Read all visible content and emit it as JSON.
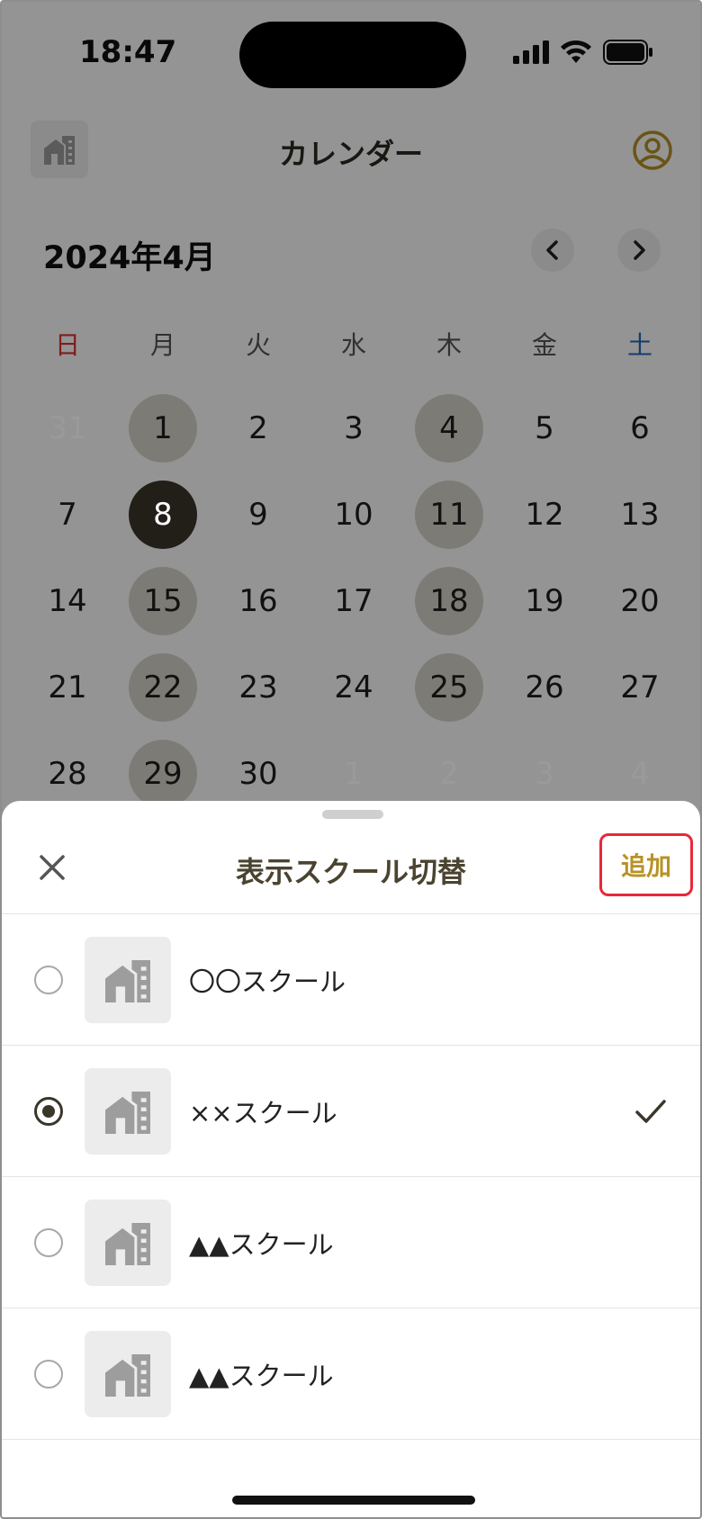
{
  "status_bar": {
    "time": "18:47"
  },
  "header": {
    "title": "カレンダー"
  },
  "calendar": {
    "month_label": "2024年4月",
    "weekdays": [
      "日",
      "月",
      "火",
      "水",
      "木",
      "金",
      "土"
    ],
    "weeks": [
      [
        {
          "d": "31",
          "outside": true
        },
        {
          "d": "1",
          "marked": true
        },
        {
          "d": "2"
        },
        {
          "d": "3"
        },
        {
          "d": "4",
          "marked": true
        },
        {
          "d": "5"
        },
        {
          "d": "6"
        }
      ],
      [
        {
          "d": "7"
        },
        {
          "d": "8",
          "selected": true
        },
        {
          "d": "9"
        },
        {
          "d": "10"
        },
        {
          "d": "11",
          "marked": true
        },
        {
          "d": "12"
        },
        {
          "d": "13"
        }
      ],
      [
        {
          "d": "14"
        },
        {
          "d": "15",
          "marked": true
        },
        {
          "d": "16"
        },
        {
          "d": "17"
        },
        {
          "d": "18",
          "marked": true
        },
        {
          "d": "19"
        },
        {
          "d": "20"
        }
      ],
      [
        {
          "d": "21"
        },
        {
          "d": "22",
          "marked": true
        },
        {
          "d": "23"
        },
        {
          "d": "24"
        },
        {
          "d": "25",
          "marked": true
        },
        {
          "d": "26"
        },
        {
          "d": "27"
        }
      ],
      [
        {
          "d": "28"
        },
        {
          "d": "29",
          "marked": true
        },
        {
          "d": "30"
        },
        {
          "d": "1",
          "outside": true
        },
        {
          "d": "2",
          "outside": true
        },
        {
          "d": "3",
          "outside": true
        },
        {
          "d": "4",
          "outside": true
        }
      ]
    ]
  },
  "sheet": {
    "title": "表示スクール切替",
    "add_label": "追加",
    "schools": [
      {
        "name": "〇〇スクール",
        "selected": false
      },
      {
        "name": "××スクール",
        "selected": true
      },
      {
        "name": "▲▲スクール",
        "selected": false
      },
      {
        "name": "▲▲スクール",
        "selected": false
      }
    ]
  },
  "colors": {
    "accent_gold": "#b79226",
    "highlight_red": "#e8283a",
    "selected_day": "#3a362a",
    "marked_day": "#d7d4ca",
    "sunday": "#d33333",
    "saturday": "#2466b8"
  }
}
